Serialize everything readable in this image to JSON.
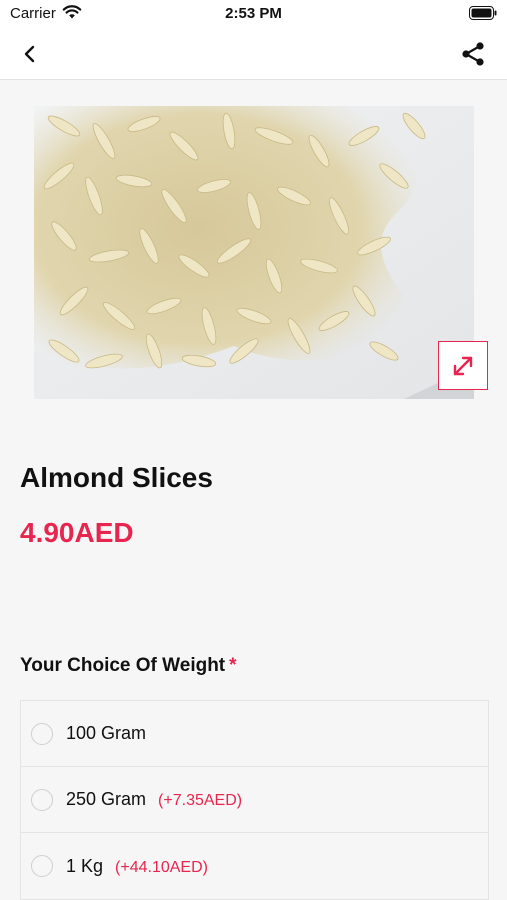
{
  "status_bar": {
    "carrier": "Carrier",
    "time": "2:53 PM"
  },
  "nav": {
    "back_icon": "chevron-left-icon",
    "share_icon": "share-icon"
  },
  "product": {
    "title": "Almond Slices",
    "price": "4.90AED",
    "image_icon": "expand-icon"
  },
  "options_section": {
    "label": "Your Choice Of Weight",
    "required_marker": "*",
    "options": [
      {
        "label": "100 Gram",
        "extra": ""
      },
      {
        "label": "250 Gram",
        "extra": "(+7.35AED)"
      },
      {
        "label": "1 Kg",
        "extra": "(+44.10AED)"
      }
    ]
  },
  "colors": {
    "accent": "#e8254f",
    "background": "#f6f6f6"
  }
}
